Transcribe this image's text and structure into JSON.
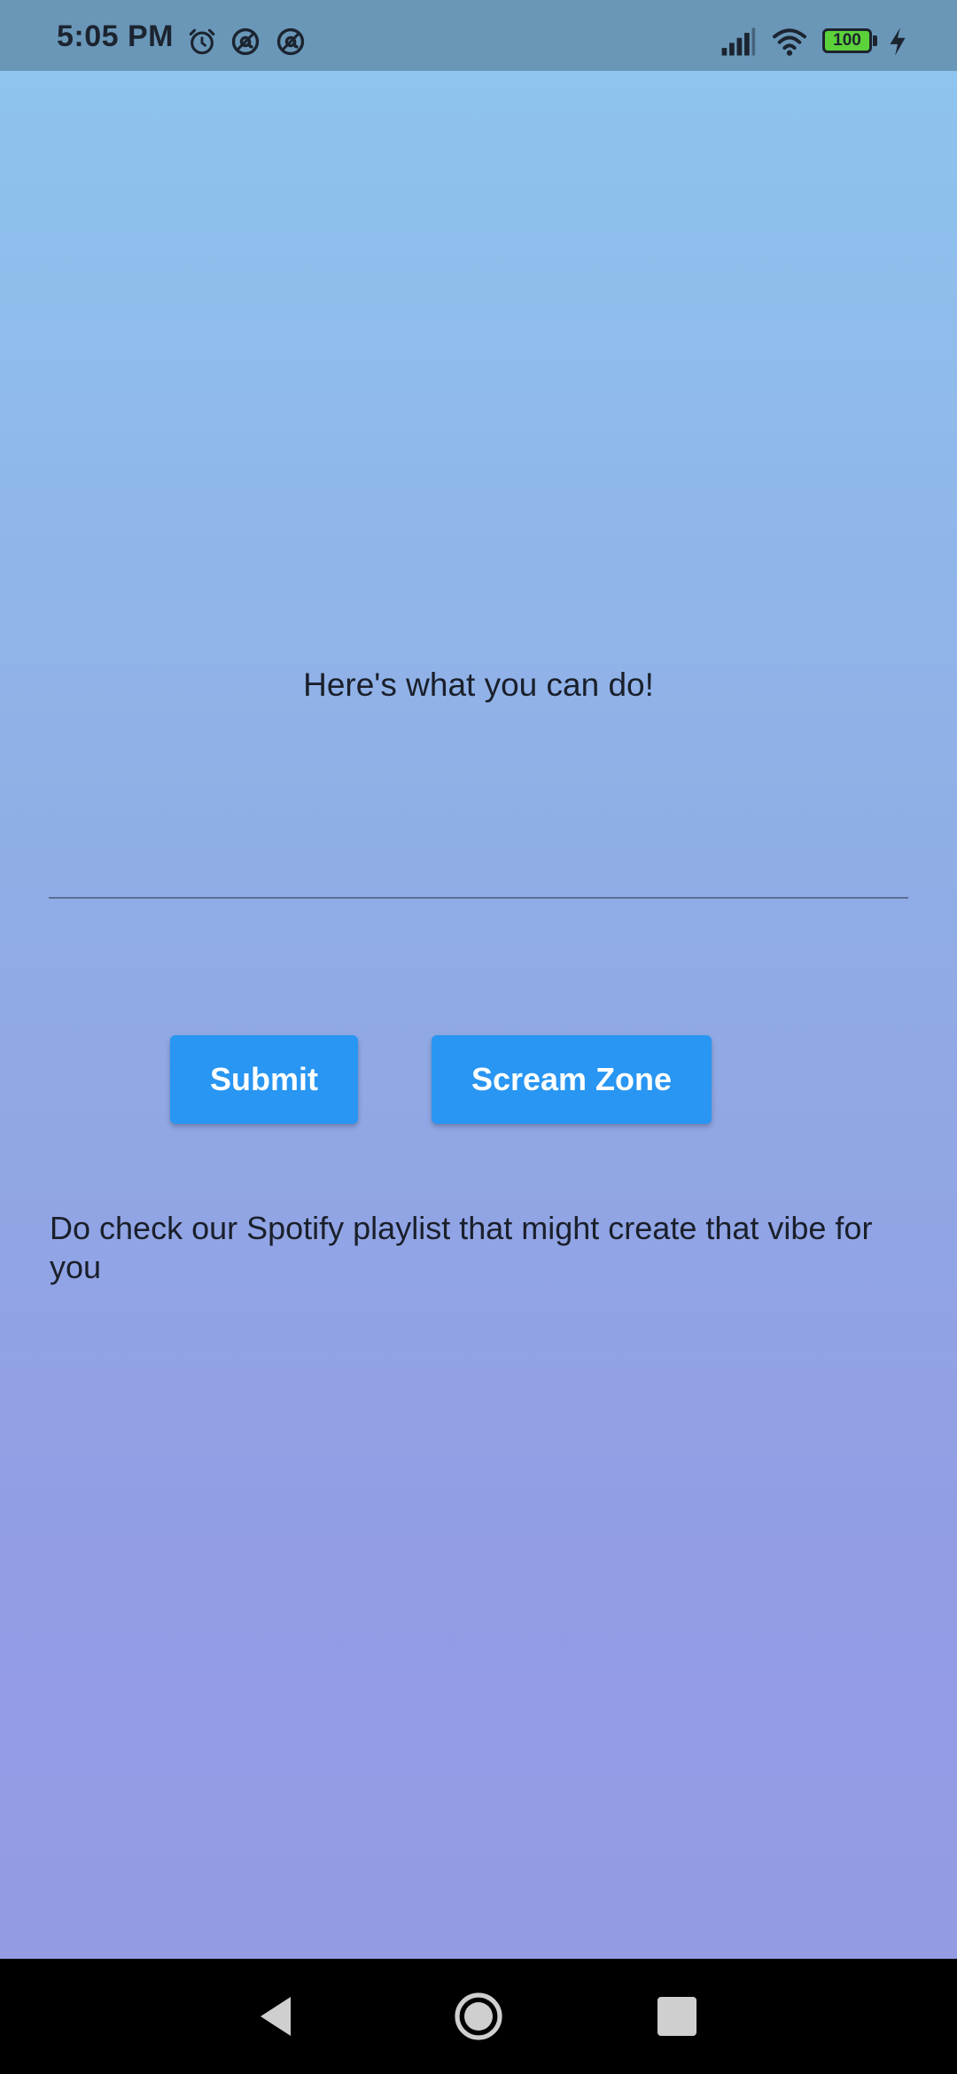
{
  "status_bar": {
    "time": "5:05 PM",
    "icons": [
      "alarm-icon",
      "at-sign-icon",
      "at-sign-icon",
      "signal-icon",
      "wifi-icon",
      "battery-icon",
      "charging-icon"
    ],
    "battery_level": "100"
  },
  "main": {
    "heading": "Here's what you can do!",
    "input": {
      "value": "",
      "placeholder": ""
    },
    "buttons": {
      "submit_label": "Submit",
      "scream_label": "Scream Zone"
    },
    "note": "Do check our Spotify playlist that might create that vibe for you"
  },
  "nav_bar": {
    "icons": [
      "back-icon",
      "home-icon",
      "recents-icon"
    ]
  },
  "colors": {
    "status_bar_bg": "#6a97b8",
    "background_top": "#8ec6ee",
    "background_bottom": "#959ae3",
    "button_bg": "#2896f2",
    "button_text": "#ffffff",
    "battery_fill": "#5cd23a",
    "nav_bar_bg": "#000000"
  }
}
